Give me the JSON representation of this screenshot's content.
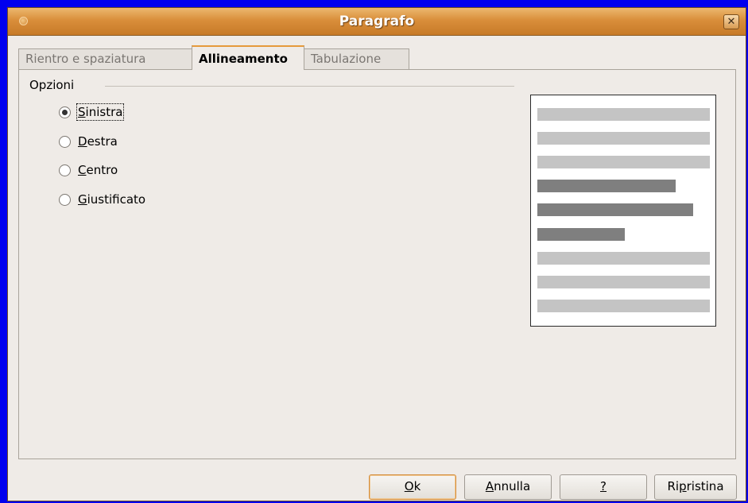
{
  "window": {
    "title": "Paragrafo",
    "close_glyph": "✕"
  },
  "tabs": [
    {
      "label": "Rientro e spaziatura",
      "active": false
    },
    {
      "label": "Allineamento",
      "active": true
    },
    {
      "label": "Tabulazione",
      "active": false
    }
  ],
  "options": {
    "group_label": "Opzioni",
    "radios": [
      {
        "mnemonic": "S",
        "rest": "inistra",
        "checked": true
      },
      {
        "mnemonic": "D",
        "rest": "estra",
        "checked": false
      },
      {
        "mnemonic": "C",
        "rest": "entro",
        "checked": false
      },
      {
        "mnemonic": "G",
        "rest": "iustificato",
        "checked": false
      }
    ]
  },
  "preview": {
    "line_colors": {
      "context": "#c4c4c4",
      "current": "#7f7f7f"
    }
  },
  "buttons": {
    "ok": {
      "mnemonic": "O",
      "rest": "k"
    },
    "cancel": {
      "mnemonic": "A",
      "rest": "nnulla"
    },
    "help": {
      "mnemonic": "?",
      "rest": ""
    },
    "reset": {
      "pre": "Ri",
      "mnemonic": "p",
      "rest": "ristina"
    }
  }
}
